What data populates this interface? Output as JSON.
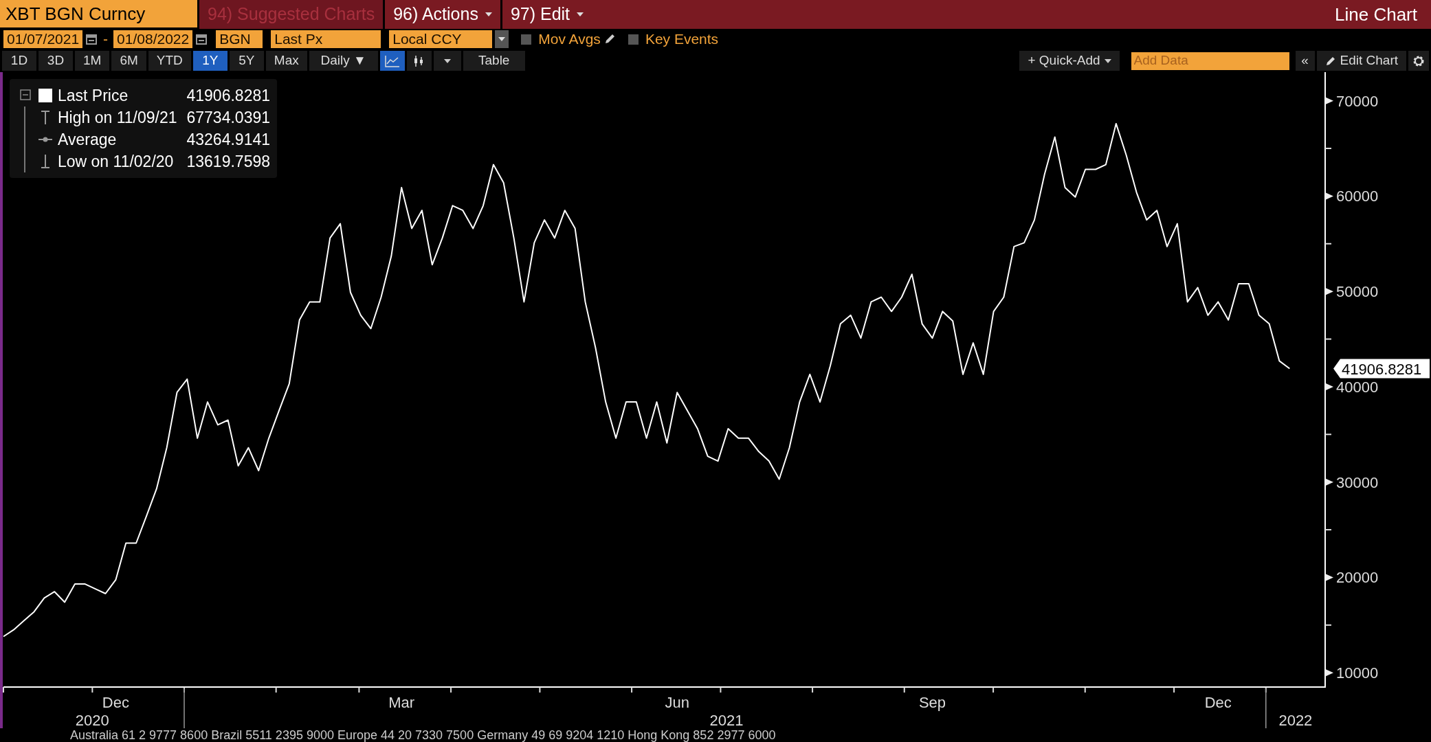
{
  "header": {
    "security": "XBT BGN Curncy",
    "menu": [
      {
        "label": "94) Suggested Charts",
        "disabled": true,
        "has_caret": false
      },
      {
        "label": "96) Actions",
        "disabled": false,
        "has_caret": true
      },
      {
        "label": "97) Edit",
        "disabled": false,
        "has_caret": true
      }
    ],
    "title": "Line Chart"
  },
  "settings": {
    "start_date": "01/07/2021",
    "date_separator": "-",
    "end_date": "01/08/2022",
    "source": "BGN",
    "field": "Last Px",
    "currency": "Local CCY",
    "options": [
      {
        "label": "Mov Avgs",
        "checked": false,
        "editable": true
      },
      {
        "label": "Key Events",
        "checked": false,
        "editable": false
      }
    ]
  },
  "toolbar": {
    "periods": [
      {
        "label": "1D",
        "selected": false
      },
      {
        "label": "3D",
        "selected": false
      },
      {
        "label": "1M",
        "selected": false
      },
      {
        "label": "6M",
        "selected": false
      },
      {
        "label": "YTD",
        "selected": false
      },
      {
        "label": "1Y",
        "selected": true
      },
      {
        "label": "5Y",
        "selected": false
      },
      {
        "label": "Max",
        "selected": false
      }
    ],
    "frequency": "Daily ▼",
    "chart_types": [
      {
        "kind": "line",
        "selected": true
      },
      {
        "kind": "bar",
        "selected": false
      }
    ],
    "table": "Table",
    "quick_add": "+ Quick-Add",
    "add_data": {
      "placeholder": "Add Data"
    },
    "collapse": "«",
    "edit_chart": "Edit Chart"
  },
  "legend": [
    {
      "kind": "series",
      "value": "41906.8281"
    },
    {
      "kind": "high",
      "label": "High on 11/09/21",
      "value": "67734.0391"
    },
    {
      "kind": "average",
      "label": "Average",
      "value": "43264.9141"
    },
    {
      "kind": "low",
      "label": "Low on 11/02/20",
      "value": "13619.7598"
    }
  ],
  "chart": {
    "chart_data": {
      "type": "line",
      "categories": [
        null,
        null,
        null,
        null,
        null,
        null,
        null,
        null,
        null,
        null,
        null,
        "Dec",
        null,
        null,
        null,
        null,
        null,
        null,
        null,
        null,
        null,
        null,
        null,
        null,
        null,
        null,
        null,
        null,
        null,
        null,
        null,
        null,
        null,
        null,
        null,
        null,
        null,
        null,
        null,
        "Mar",
        null,
        null,
        null,
        null,
        null,
        null,
        null,
        null,
        null,
        null,
        null,
        null,
        null,
        null,
        null,
        null,
        null,
        null,
        null,
        null,
        null,
        null,
        null,
        null,
        null,
        null,
        "Jun",
        null,
        null,
        null,
        null,
        null,
        null,
        null,
        null,
        null,
        null,
        null,
        null,
        null,
        null,
        null,
        null,
        null,
        null,
        null,
        null,
        null,
        null,
        null,
        null,
        "Sep",
        null,
        null,
        null,
        null,
        null,
        null,
        null,
        null,
        null,
        null,
        null,
        null,
        null,
        null,
        null,
        null,
        null,
        null,
        null,
        null,
        null,
        null,
        null,
        null,
        null,
        null,
        null,
        "Dec",
        null,
        null,
        null,
        null,
        null,
        null,
        null
      ],
      "series": [
        {
          "name": "Last Price",
          "color": "#ffffff",
          "values": [
            13800,
            14500,
            15450,
            16400,
            17850,
            18500,
            17400,
            19300,
            19300,
            18800,
            18300,
            19750,
            23600,
            23600,
            26400,
            29300,
            33600,
            39400,
            40800,
            34600,
            38400,
            36000,
            36500,
            31700,
            33600,
            31200,
            34600,
            37500,
            40300,
            47000,
            48900,
            48900,
            55600,
            57100,
            49900,
            47500,
            46100,
            49400,
            53700,
            60900,
            56600,
            58500,
            52800,
            55600,
            59000,
            58500,
            56600,
            59000,
            63300,
            61400,
            55600,
            48900,
            55100,
            57500,
            55600,
            58500,
            56600,
            48900,
            44100,
            38400,
            34600,
            38400,
            38400,
            34600,
            38400,
            34100,
            39400,
            37500,
            35600,
            32700,
            32200,
            35600,
            34600,
            34600,
            33200,
            32200,
            30300,
            33600,
            38400,
            41300,
            38400,
            42200,
            46600,
            47500,
            45100,
            48900,
            49400,
            47900,
            49400,
            51800,
            46600,
            45100,
            47900,
            46900,
            41300,
            44600,
            41300,
            47900,
            49400,
            54700,
            55100,
            57500,
            62300,
            66200,
            60900,
            59900,
            62800,
            62800,
            63300,
            67600,
            64300,
            60400,
            57500,
            58500,
            54700,
            57100,
            48900,
            50400,
            47500,
            48900,
            47000,
            50800,
            50800,
            47500,
            46600,
            42700,
            41900
          ]
        }
      ],
      "ylim": [
        8500,
        73000
      ],
      "yticks": [
        10000,
        20000,
        30000,
        40000,
        50000,
        60000,
        70000
      ],
      "annotations": [
        "41906.8281",
        "2020",
        "2021",
        "2022"
      ]
    }
  },
  "footer_ticker": "Australia 61 2 9777 8600 Brazil 5511 2395 9000 Europe 44 20 7330 7500 Germany 49 69 9204 1210 Hong Kong 852 2977 6000"
}
